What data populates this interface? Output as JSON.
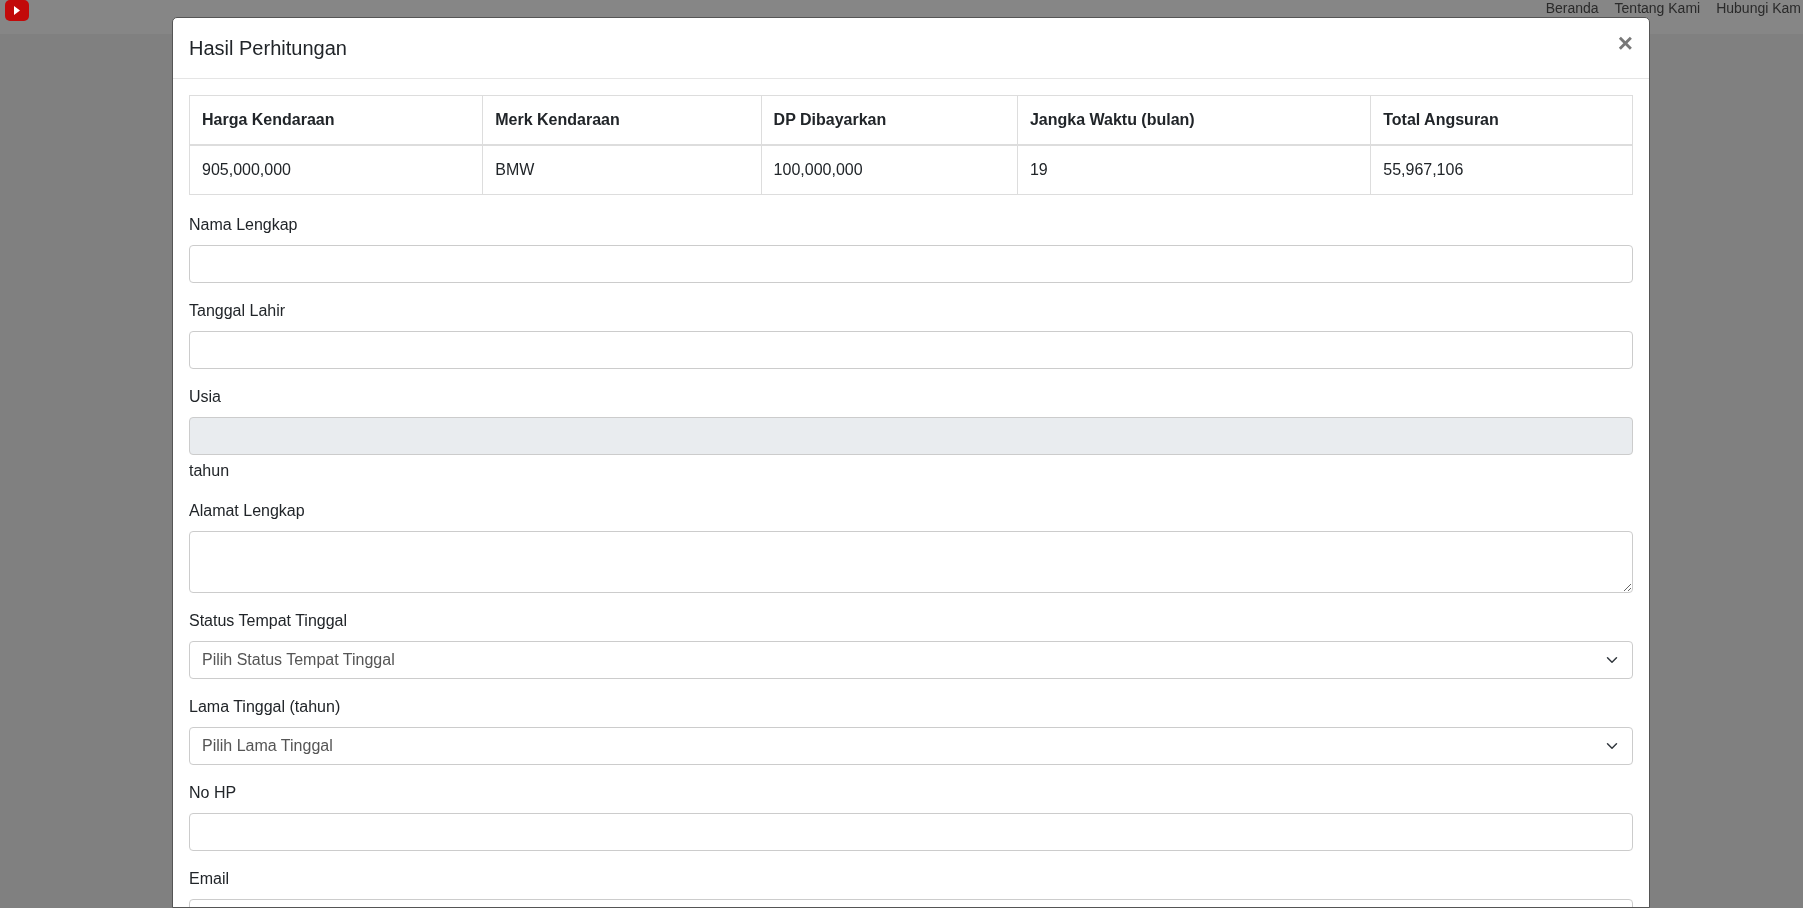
{
  "navbar": {
    "links": [
      "Beranda",
      "Tentang Kami",
      "Hubungi Kam"
    ]
  },
  "modal": {
    "title": "Hasil Perhitungan",
    "close": "×",
    "table": {
      "columns": [
        "Harga Kendaraan",
        "Merk Kendaraan",
        "DP Dibayarkan",
        "Jangka Waktu (bulan)",
        "Total Angsuran"
      ],
      "rows": [
        [
          "905,000,000",
          "BMW",
          "100,000,000",
          "19",
          "55,967,106"
        ]
      ]
    },
    "fields": [
      {
        "kind": "text",
        "label": "Nama Lengkap"
      },
      {
        "kind": "text",
        "label": "Tanggal Lahir"
      },
      {
        "kind": "text",
        "label": "Usia",
        "disabled": true,
        "suffix": "tahun"
      },
      {
        "kind": "textarea",
        "label": "Alamat Lengkap"
      },
      {
        "kind": "select",
        "label": "Status Tempat Tinggal",
        "value": "Pilih Status Tempat Tinggal"
      },
      {
        "kind": "select",
        "label": "Lama Tinggal (tahun)",
        "value": "Pilih Lama Tinggal"
      },
      {
        "kind": "text",
        "label": "No HP"
      },
      {
        "kind": "text",
        "label": "Email"
      }
    ]
  }
}
